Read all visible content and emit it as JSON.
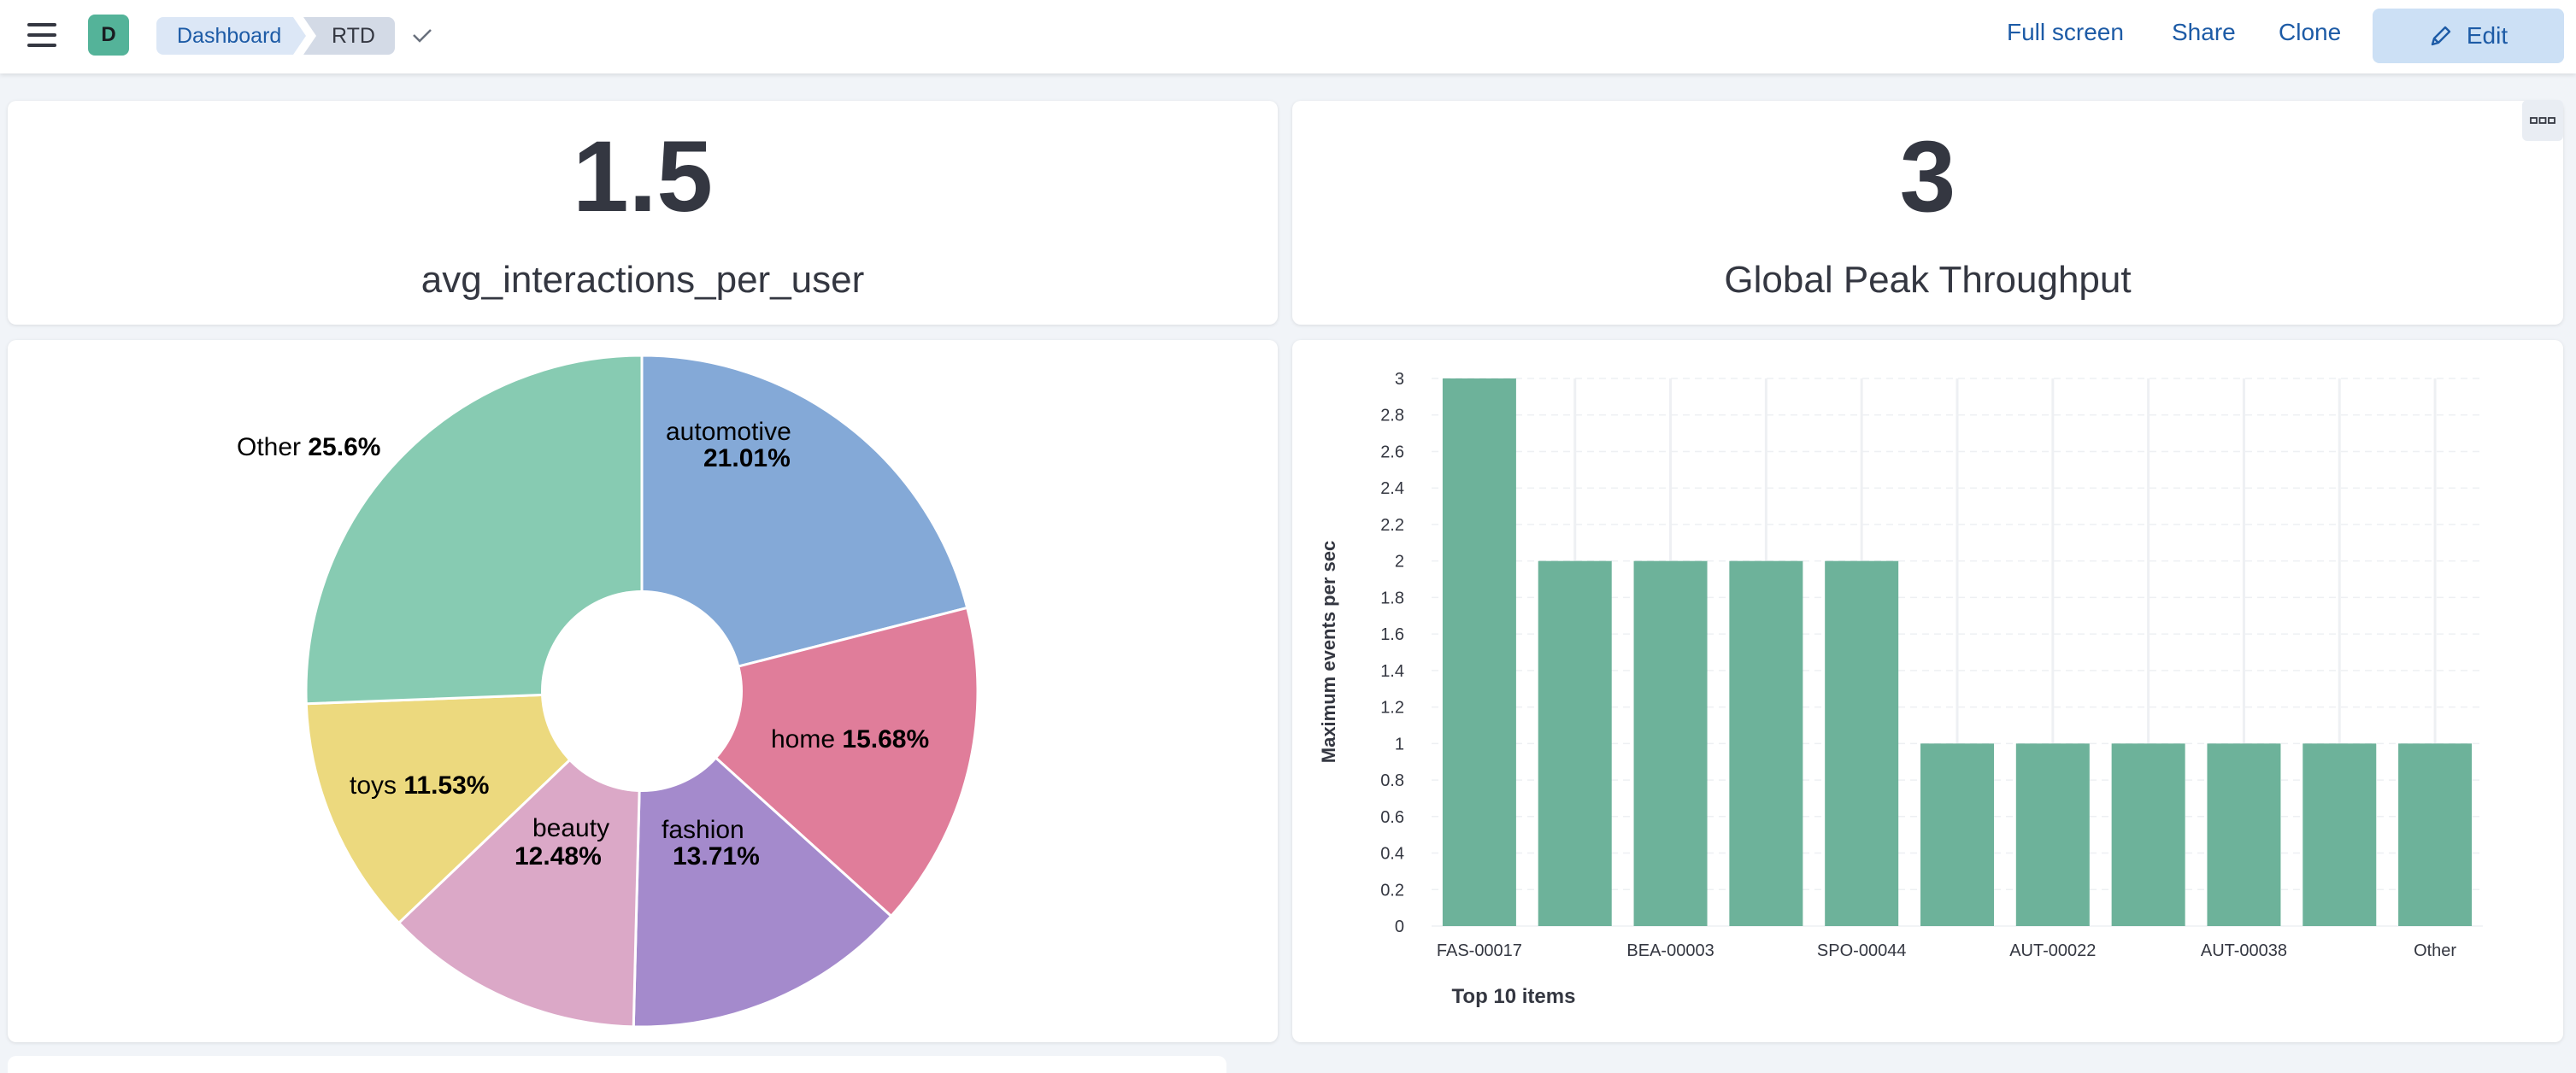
{
  "header": {
    "avatar_letter": "D",
    "breadcrumb": [
      "Dashboard",
      "RTD"
    ],
    "actions": [
      "Full screen",
      "Share",
      "Clone",
      "Edit"
    ]
  },
  "metrics": [
    {
      "value": "1.5",
      "label": "avg_interactions_per_user"
    },
    {
      "value": "3",
      "label": "Global Peak Throughput"
    }
  ],
  "pie": {
    "type": "pie",
    "slices": [
      {
        "name": "automotive",
        "value": 21.01,
        "label": "21.01%",
        "color": "#84a9d7"
      },
      {
        "name": "home",
        "value": 15.68,
        "label": "15.68%",
        "color": "#e07d9a"
      },
      {
        "name": "fashion",
        "value": 13.71,
        "label": "13.71%",
        "color": "#a48acc"
      },
      {
        "name": "beauty",
        "value": 12.48,
        "label": "12.48%",
        "color": "#dba8c7"
      },
      {
        "name": "toys",
        "value": 11.53,
        "label": "11.53%",
        "color": "#ecd97e"
      },
      {
        "name": "Other",
        "value": 25.6,
        "label": "25.6%",
        "color": "#87cbb2"
      }
    ]
  },
  "chart_data": {
    "type": "bar",
    "categories": [
      "FAS-00017",
      "",
      "BEA-00003",
      "",
      "SPO-00044",
      "",
      "AUT-00022",
      "",
      "AUT-00038",
      "",
      "Other"
    ],
    "values": [
      3,
      2,
      2,
      2,
      2,
      1,
      1,
      1,
      1,
      1,
      1
    ],
    "xlabel": "Top 10 items",
    "ylabel": "Maximum events per sec",
    "ylim": [
      0,
      3
    ],
    "yticks": [
      "0",
      "0.2",
      "0.4",
      "0.6",
      "0.8",
      "1",
      "1.2",
      "1.4",
      "1.6",
      "1.8",
      "2",
      "2.2",
      "2.4",
      "2.6",
      "2.8",
      "3"
    ],
    "bar_color": "#6db29a"
  }
}
